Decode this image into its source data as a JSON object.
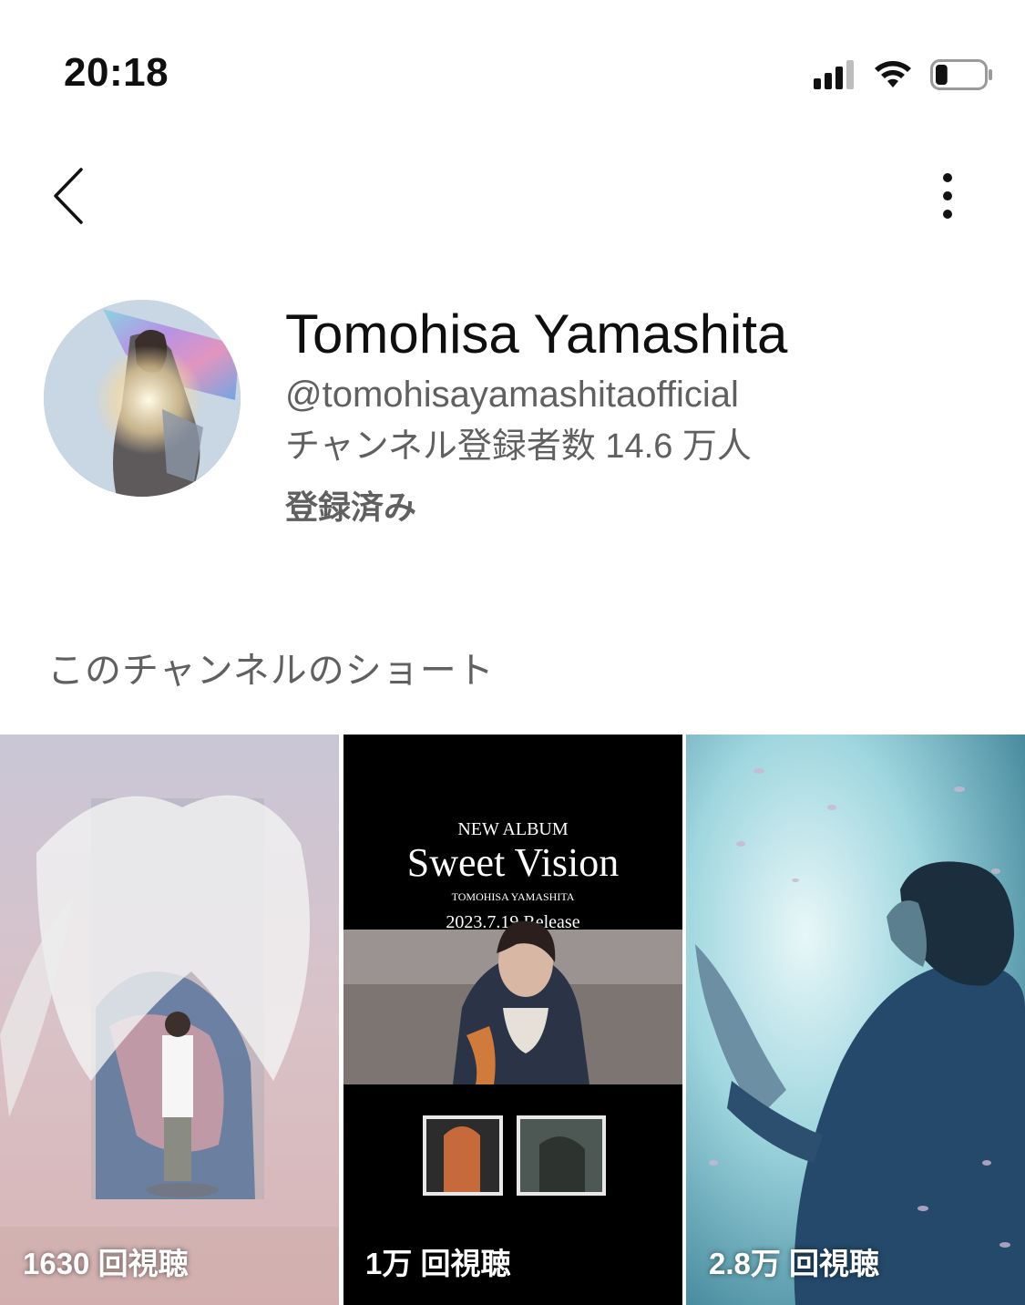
{
  "status_bar": {
    "time": "20:18",
    "icons": [
      "cellular-signal-icon",
      "wifi-icon",
      "battery-icon"
    ],
    "battery_level": 0.25
  },
  "header": {
    "back_icon": "chevron-left-icon",
    "more_icon": "more-vertical-icon"
  },
  "channel": {
    "name": "Tomohisa Yamashita",
    "handle": "@tomohisayamashitaofficial",
    "subscribers": "チャンネル登録者数 14.6 万人",
    "subscribed_label": "登録済み"
  },
  "shorts": {
    "section_title": "このチャンネルのショート",
    "items": [
      {
        "views": "1630 回視聴"
      },
      {
        "views": "1万 回視聴",
        "thumb_text": {
          "kicker": "NEW ALBUM",
          "title": "Sweet Vision",
          "artist": "TOMOHISA YAMASHITA",
          "release": "2023.7.19 Release"
        }
      },
      {
        "views": "2.8万 回視聴"
      }
    ]
  },
  "colors": {
    "text_primary": "#0f0f0f",
    "text_secondary": "#606060",
    "background": "#ffffff"
  }
}
